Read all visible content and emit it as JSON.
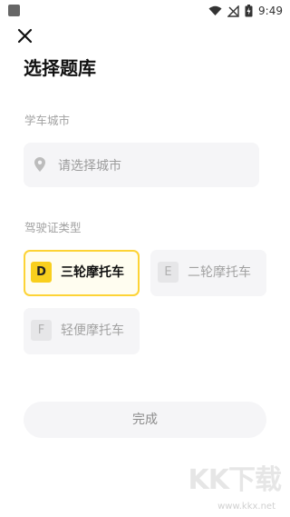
{
  "status_bar": {
    "time": "9:49",
    "wifi_icon": "wifi-icon",
    "signal_icon": "signal-off-icon",
    "battery_icon": "battery-charging-icon"
  },
  "header": {
    "close_icon": "close-icon",
    "title": "选择题库"
  },
  "city_section": {
    "label": "学车城市",
    "placeholder": "请选择城市",
    "icon": "location-pin-icon"
  },
  "license_section": {
    "label": "驾驶证类型",
    "options": [
      {
        "code": "D",
        "label": "三轮摩托车",
        "selected": true
      },
      {
        "code": "E",
        "label": "二轮摩托车",
        "selected": false
      },
      {
        "code": "F",
        "label": "轻便摩托车",
        "selected": false
      }
    ]
  },
  "done_label": "完成",
  "watermark": {
    "brand": "KK下载",
    "url": "www.kkx.net"
  },
  "colors": {
    "accent": "#f9cf1e",
    "accent_border": "#fdd336",
    "field_bg": "#f5f5f7",
    "muted_text": "#a2a2a2"
  }
}
